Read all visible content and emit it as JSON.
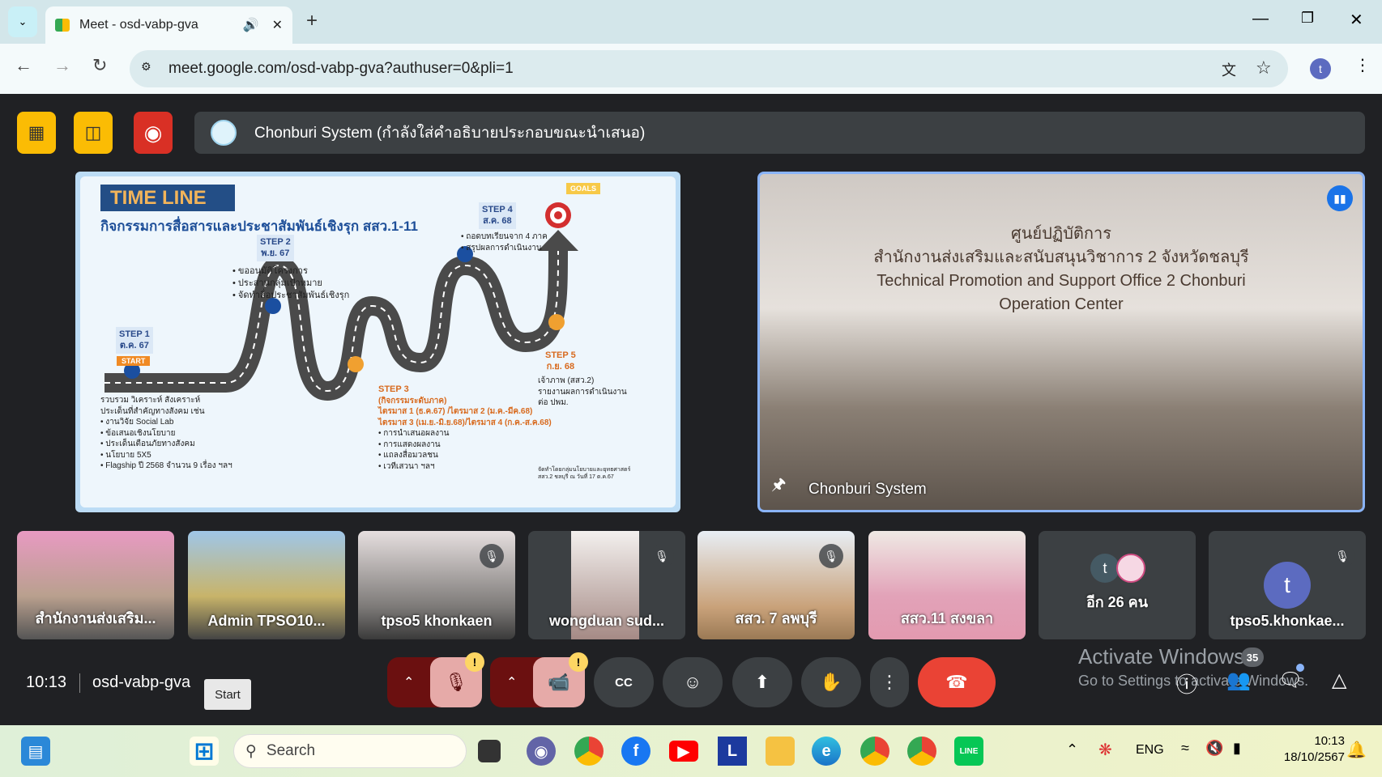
{
  "browser": {
    "tab_title": "Meet - osd-vabp-gva",
    "url": "meet.google.com/osd-vabp-gva?authuser=0&pli=1",
    "profile_initial": "t"
  },
  "meet": {
    "presenter_banner": "Chonburi System (กำลังใส่คำอธิบายประกอบขณะนำเสนอ)",
    "slide": {
      "title": "TIME LINE",
      "subtitle": "กิจกรรมการสื่อสารและประชาสัมพันธ์เชิงรุก สสว.1-11",
      "goals": "GOALS",
      "start": "START",
      "step1": {
        "label": "STEP 1",
        "date": "ต.ค. 67",
        "text": [
          "รวบรวม วิเคราะห์ สังเคราะห์",
          "ประเด็นที่สำคัญทางสังคม เช่น"
        ],
        "bullets": [
          "งานวิจัย Social Lab",
          "ข้อเสนอเชิงนโยบาย",
          "ประเด็นเตือนภัยทางสังคม",
          "นโยบาย 5X5",
          "Flagship ปี 2568 จำนวน 9 เรื่อง ฯลฯ"
        ]
      },
      "step2": {
        "label": "STEP 2",
        "date": "พ.ย. 67",
        "bullets": [
          "ขออนุมัติโครงการ",
          "ประสานกลุ่มเป้าหมาย",
          "จัดทำสื่อประชาสัมพันธ์เชิงรุก"
        ]
      },
      "step3": {
        "label": "STEP 3",
        "sub": "(กิจกรรมระดับภาค)",
        "q1": "ไตรมาส 1  (ธ.ค.67) /ไตรมาส 2 (ม.ค.-มีค.68)",
        "q2": "ไตรมาส 3 (เม.ย.-มิ.ย.68)/ไตรมาส 4 (ก.ค.-ส.ค.68)",
        "bullets": [
          "การนำเสนอผลงาน",
          "การแสดงผลงาน",
          "แถลงสื่อมวลชน",
          "เวทีเสวนา ฯลฯ"
        ]
      },
      "step4": {
        "label": "STEP 4",
        "date": "ส.ค. 68",
        "bullets": [
          "ถอดบทเรียนจาก 4 ภาค",
          "สรุปผลการดำเนินงาน"
        ]
      },
      "step5": {
        "label": "STEP 5",
        "date": "ก.ย. 68",
        "text": [
          "เจ้าภาพ (สสว.2)",
          "รายงานผลการดำเนินงาน",
          "ต่อ ปพม."
        ]
      },
      "credit": [
        "จัดทำโดยกลุ่มนโยบายและยุทธศาสตร์",
        "สสว.2 ชลบุรี ณ วันที่ 17 ต.ค.67"
      ]
    },
    "video": {
      "name": "Chonburi System",
      "sign_th1": "ศูนย์ปฏิบัติการ",
      "sign_th2": "สำนักงานส่งเสริมและสนับสนุนวิชาการ 2 จังหวัดชลบุรี",
      "sign_en1": "Technical Promotion and Support Office 2 Chonburi",
      "sign_en2": "Operation Center"
    },
    "tiles": [
      {
        "name": "สำนักงานส่งเสริม...",
        "muted": false
      },
      {
        "name": "Admin TPSO10...",
        "muted": false
      },
      {
        "name": "tpso5 khonkaen",
        "muted": true
      },
      {
        "name": "wongduan sud...",
        "muted": true
      },
      {
        "name": "สสว. 7 ลพบุรี",
        "muted": true
      },
      {
        "name": "สสว.11 สงขลา",
        "muted": false
      },
      {
        "name": "อีก 26 คน",
        "avatar": "t",
        "muted": false
      },
      {
        "name": "tpso5.khonkae...",
        "avatar": "t",
        "muted": true
      }
    ],
    "time": "10:13",
    "meeting_code": "osd-vabp-gva",
    "tooltip": "Start",
    "participants_count": "35",
    "watermark": {
      "line1": "Activate Windows",
      "line2": "Go to Settings to activate Windows."
    }
  },
  "taskbar": {
    "search_placeholder": "Search",
    "lang": "ENG",
    "clock_time": "10:13",
    "clock_date": "18/10/2567"
  },
  "colors": {
    "accent": "#8ab4f8",
    "end_call": "#ea4335",
    "warning": "#fdd663"
  }
}
